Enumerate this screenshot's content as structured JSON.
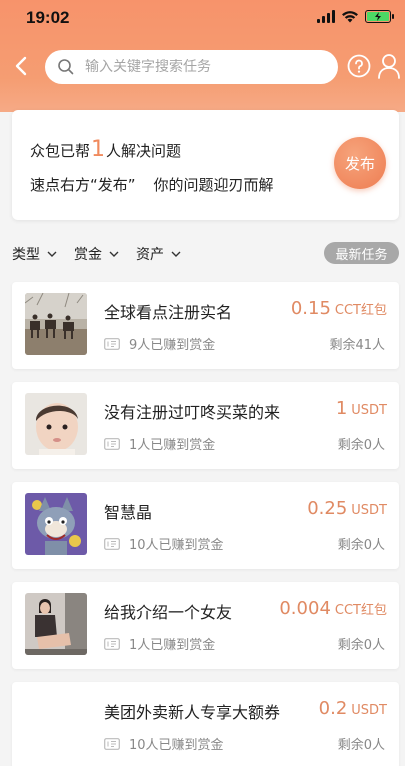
{
  "status_bar": {
    "time": "19:02"
  },
  "search": {
    "placeholder": "输入关键字搜索任务"
  },
  "promo": {
    "prefix": "众包已帮",
    "count": "1",
    "suffix": "人解决问题",
    "hint_left": "速点右方“发布”",
    "hint_right": "你的问题迎刃而解",
    "publish_label": "发布"
  },
  "filters": {
    "type_label": "类型",
    "reward_label": "赏金",
    "asset_label": "资产",
    "latest_label": "最新任务"
  },
  "colors": {
    "accent": "#f08a5d",
    "reward_text": "#e08a63",
    "header": "#f7936b"
  },
  "tasks": [
    {
      "title": "全球看点注册实名",
      "earned": "9人已赚到赏金",
      "amount": "0.15",
      "unit": "CCT红包",
      "remain": "剩余41人",
      "thumb": "horses-photo"
    },
    {
      "title": "没有注册过叮咚买菜的来",
      "earned": "1人已赚到赏金",
      "amount": "1",
      "unit": "USDT",
      "remain": "剩余0人",
      "thumb": "child-photo"
    },
    {
      "title": "智慧晶",
      "earned": "10人已赚到赏金",
      "amount": "0.25",
      "unit": "USDT",
      "remain": "剩余0人",
      "thumb": "cartoon-cat-photo"
    },
    {
      "title": "给我介绍一个女友",
      "earned": "1人已赚到赏金",
      "amount": "0.004",
      "unit": "CCT红包",
      "remain": "剩余0人",
      "thumb": "woman-photo"
    },
    {
      "title": "美团外卖新人专享大额券",
      "earned": "10人已赚到赏金",
      "amount": "0.2",
      "unit": "USDT",
      "remain": "剩余0人",
      "thumb": "blank"
    }
  ]
}
